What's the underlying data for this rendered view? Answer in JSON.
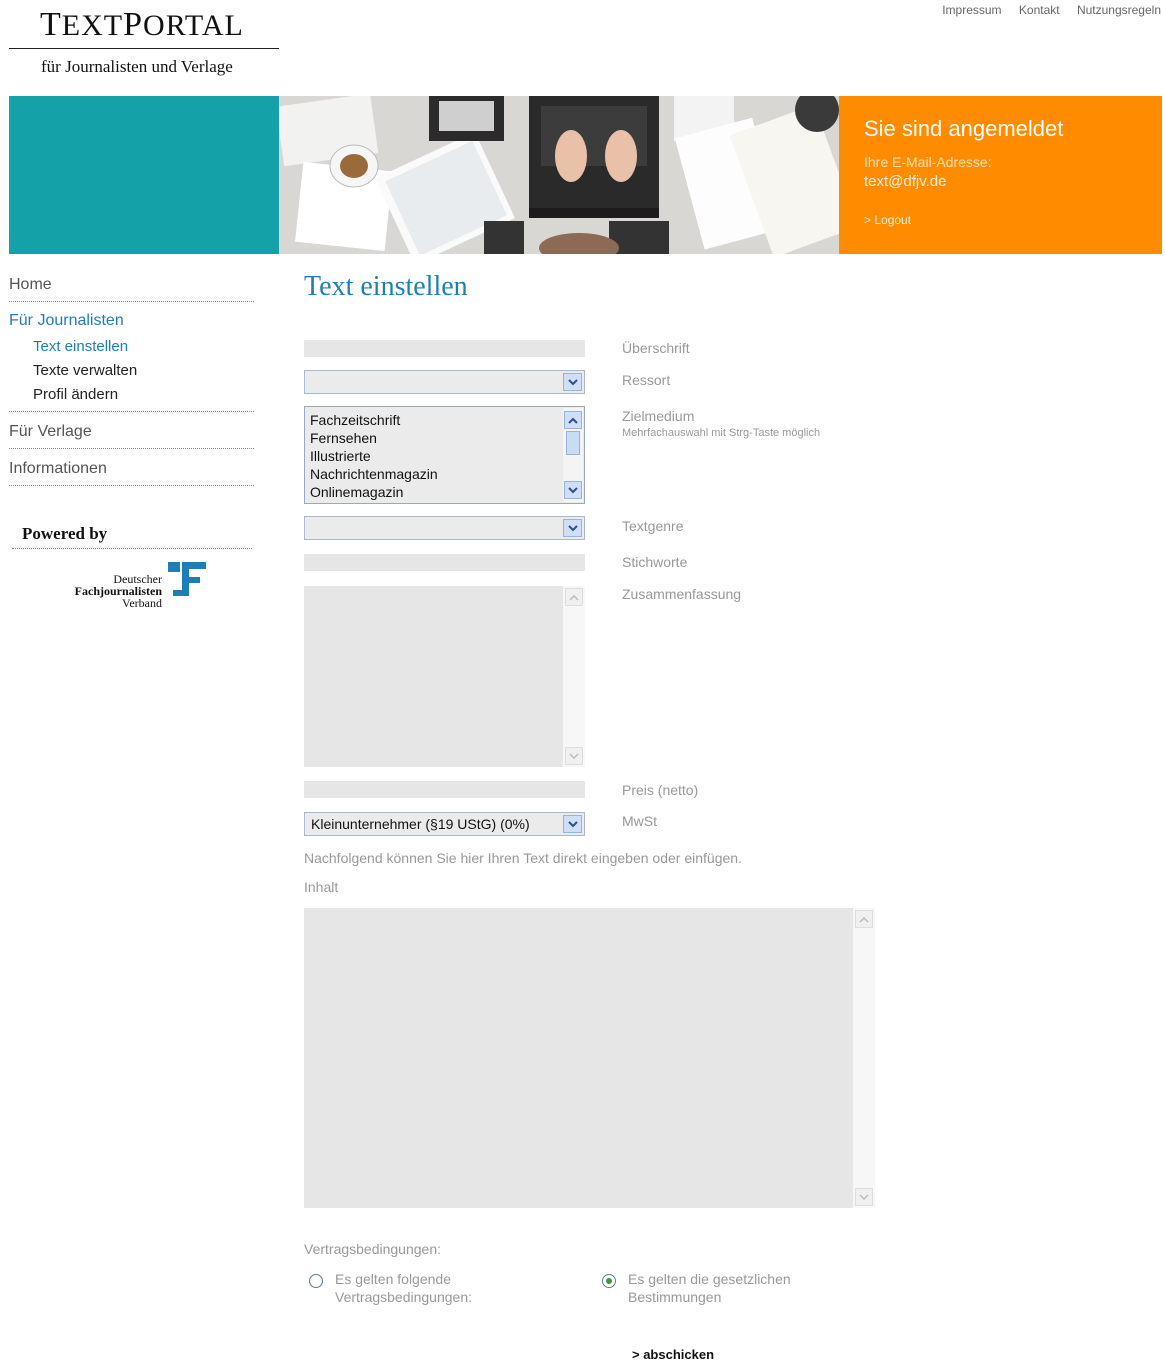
{
  "header": {
    "logo_first": "T",
    "logo_rest1": "EXT",
    "logo_p": "P",
    "logo_rest2": "ORTAL",
    "logo_subtitle": "für Journalisten und Verlage",
    "top_links": [
      "Impressum",
      "Kontakt",
      "Nutzungsregeln"
    ]
  },
  "login_box": {
    "title": "Sie sind angemeldet",
    "email_label": "Ihre E-Mail-Adresse:",
    "email": "text@dfjv.de",
    "logout": "> Logout"
  },
  "sidebar": {
    "home": "Home",
    "journalists": "Für Journalisten",
    "journalist_items": [
      "Text einstellen",
      "Texte verwalten",
      "Profil ändern"
    ],
    "publishers": "Für Verlage",
    "info": "Informationen",
    "powered_by": "Powered by",
    "partner_logo": {
      "line1": "Deutscher",
      "line2": "Fachjournalisten",
      "line3": "Verband"
    }
  },
  "form": {
    "page_title": "Text einstellen",
    "labels": {
      "headline": "Überschrift",
      "ressort": "Ressort",
      "target_medium": "Zielmedium",
      "target_hint": "Mehrfachauswahl mit Strg-Taste möglich",
      "genre": "Textgenre",
      "keywords": "Stichworte",
      "summary": "Zusammenfassung",
      "price": "Preis (netto)",
      "vat": "MwSt"
    },
    "target_options": [
      "Fachzeitschrift",
      "Fernsehen",
      "Illustrierte",
      "Nachrichtenmagazin",
      "Onlinemagazin"
    ],
    "vat_value": "Kleinunternehmer (§19 UStG) (0%)",
    "intro": "Nachfolgend können Sie hier Ihren Text direkt eingeben oder einfügen.",
    "content_label": "Inhalt",
    "contract_label": "Vertragsbedingungen:",
    "contract_option1_line1": "Es gelten folgende",
    "contract_option1_line2": "Vertragsbedingungen:",
    "contract_option2_line1": "Es gelten die gesetzlichen",
    "contract_option2_line2": "Bestimmungen",
    "selected_contract": "option2",
    "submit": "> abschicken"
  },
  "colors": {
    "teal": "#14A1A8",
    "orange": "#FF8C00",
    "link_blue": "#1E7FB8"
  }
}
